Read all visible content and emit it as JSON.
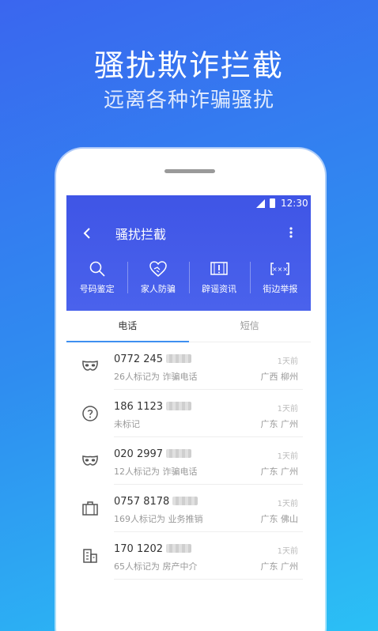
{
  "hero": {
    "title": "骚扰欺诈拦截",
    "subtitle": "远离各种诈骗骚扰"
  },
  "status_bar": {
    "time": "12:30"
  },
  "header": {
    "title": "骚扰拦截"
  },
  "tools": [
    {
      "label": "号码鉴定",
      "icon": "search-icon"
    },
    {
      "label": "家人防骗",
      "icon": "heart-hands-icon"
    },
    {
      "label": "辟谣资讯",
      "icon": "alert-panel-icon"
    },
    {
      "label": "街边举报",
      "icon": "masked-text-icon"
    }
  ],
  "tabs": [
    {
      "label": "电话",
      "active": true
    },
    {
      "label": "短信",
      "active": false
    }
  ],
  "calls": [
    {
      "number": "0772 245",
      "note": "26人标记为 诈骗电话",
      "time": "1天前",
      "location": "广西 柳州",
      "icon": "mask-icon"
    },
    {
      "number": "186 1123",
      "note": "未标记",
      "time": "1天前",
      "location": "广东 广州",
      "icon": "question-icon"
    },
    {
      "number": "020 2997",
      "note": "12人标记为 诈骗电话",
      "time": "1天前",
      "location": "广东 广州",
      "icon": "mask-icon"
    },
    {
      "number": "0757 8178",
      "note": "169人标记为 业务推销",
      "time": "1天前",
      "location": "广东 佛山",
      "icon": "briefcase-icon"
    },
    {
      "number": "170 1202",
      "note": "65人标记为 房产中介",
      "time": "1天前",
      "location": "广东 广州",
      "icon": "building-icon"
    }
  ],
  "colors": {
    "header": "#3f55e6",
    "tab_indicator": "#3f8ff0"
  }
}
